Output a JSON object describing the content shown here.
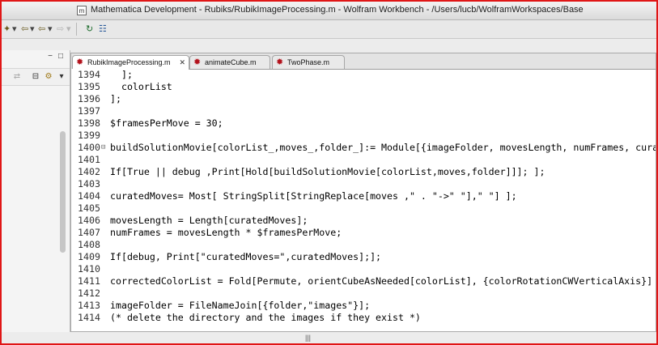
{
  "window": {
    "title": "Mathematica Development - Rubiks/RubikImageProcessing.m - Wolfram Workbench - /Users/lucb/WolframWorkspaces/Base",
    "title_icon_glyph": "m"
  },
  "toolbar": {
    "icons": [
      "wand-icon",
      "back-icon",
      "forward-icon",
      "refresh-icon",
      "table-icon"
    ]
  },
  "editor": {
    "tabs": [
      {
        "label": "RubikImageProcessing.m",
        "active": true,
        "close": "✕"
      },
      {
        "label": "animateCube.m",
        "active": false
      },
      {
        "label": "TwoPhase.m",
        "active": false
      }
    ],
    "lines": [
      {
        "n": "1394",
        "t": "  ];"
      },
      {
        "n": "1395",
        "t": "  colorList"
      },
      {
        "n": "1396",
        "t": "];"
      },
      {
        "n": "1397",
        "t": ""
      },
      {
        "n": "1398",
        "t": "$framesPerMove = 30;"
      },
      {
        "n": "1399",
        "t": ""
      },
      {
        "n": "1400",
        "t": "buildSolutionMovie[colorList_,moves_,folder_]:= Module[{imageFolder, movesLength, numFrames, curat",
        "fold": "⊟"
      },
      {
        "n": "1401",
        "t": ""
      },
      {
        "n": "1402",
        "t": "If[True || debug ,Print[Hold[buildSolutionMovie[colorList,moves,folder]]]; ];"
      },
      {
        "n": "1403",
        "t": ""
      },
      {
        "n": "1404",
        "t": "curatedMoves= Most[ StringSplit[StringReplace[moves ,\" . \"->\" \"],\" \"] ];"
      },
      {
        "n": "1405",
        "t": ""
      },
      {
        "n": "1406",
        "t": "movesLength = Length[curatedMoves];"
      },
      {
        "n": "1407",
        "t": "numFrames = movesLength * $framesPerMove;"
      },
      {
        "n": "1408",
        "t": ""
      },
      {
        "n": "1409",
        "t": "If[debug, Print[\"curatedMoves=\",curatedMoves];];"
      },
      {
        "n": "1410",
        "t": ""
      },
      {
        "n": "1411",
        "t": "correctedColorList = Fold[Permute, orientCubeAsNeeded[colorList], {colorRotationCWVerticalAxis}]"
      },
      {
        "n": "1412",
        "t": ""
      },
      {
        "n": "1413",
        "t": "imageFolder = FileNameJoin[{folder,\"images\"}];"
      },
      {
        "n": "1414",
        "t": "(* delete the directory and the images if they exist *)"
      }
    ]
  },
  "status": {
    "grip": "|||"
  }
}
